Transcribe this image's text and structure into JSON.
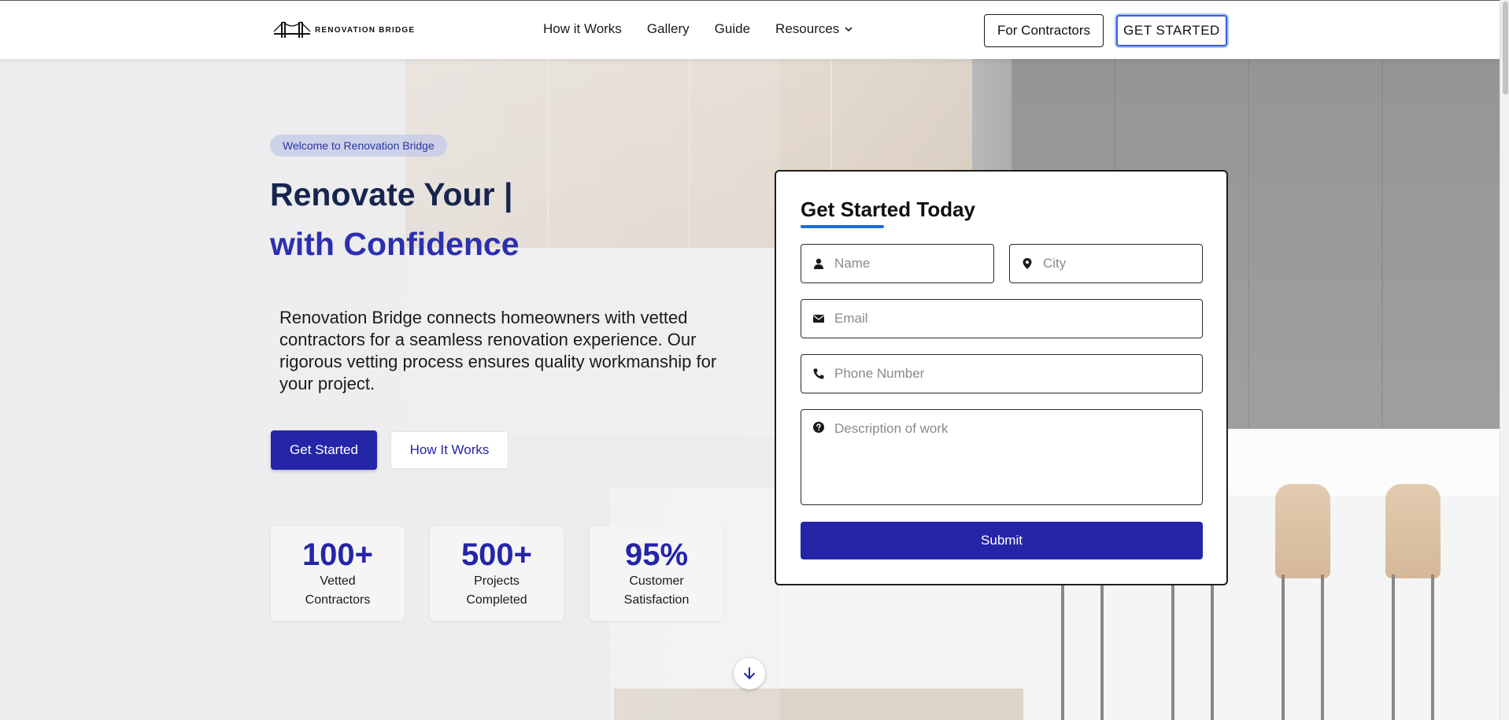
{
  "nav": {
    "logo_text": "RENOVATION BRIDGE",
    "links": [
      "How it Works",
      "Gallery",
      "Guide",
      "Resources"
    ],
    "contractors_label": "For Contractors",
    "get_started_label": "GET STARTED"
  },
  "hero": {
    "badge": "Welcome to Renovation Bridge",
    "headline_line1": "Renovate Your |",
    "headline_line2": "with Confidence",
    "intro": "Renovation Bridge connects homeowners with vetted contractors for a seamless renovation experience. Our rigorous vetting process ensures quality workmanship for your project.",
    "primary_button": "Get Started",
    "secondary_button": "How It Works"
  },
  "stats": [
    {
      "value": "100+",
      "label": "Vetted Contractors"
    },
    {
      "value": "500+",
      "label": "Projects Completed"
    },
    {
      "value": "95%",
      "label": "Customer Satisfaction"
    }
  ],
  "form": {
    "title": "Get Started Today",
    "name_placeholder": "Name",
    "city_placeholder": "City",
    "email_placeholder": "Email",
    "phone_placeholder": "Phone Number",
    "description_placeholder": "Description of work",
    "submit_label": "Submit"
  },
  "colors": {
    "primary": "#2525a8",
    "heading_dark": "#17254e",
    "accent_underline": "#1b6fd6"
  },
  "icons": {
    "scroll": "arrow-down-icon",
    "name": "user-icon",
    "city": "map-pin-icon",
    "email": "envelope-icon",
    "phone": "phone-icon",
    "description": "question-circle-icon",
    "dropdown": "chevron-down-icon"
  }
}
